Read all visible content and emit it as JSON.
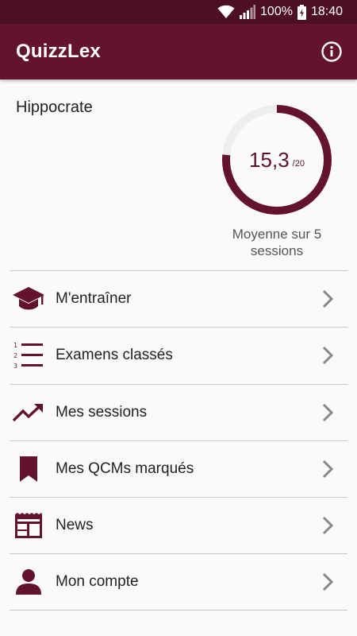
{
  "status_bar": {
    "battery_percent": "100%",
    "time": "18:40",
    "icons": [
      "wifi-icon",
      "signal-icon",
      "battery-icon"
    ]
  },
  "app_bar": {
    "title": "QuizzLex",
    "info_icon": "info-icon"
  },
  "profile": {
    "name": "Hippocrate",
    "score": "15,3",
    "score_max": "/20",
    "score_fraction": 0.765,
    "caption": "Moyenne sur 5 sessions"
  },
  "menu": {
    "items": [
      {
        "label": "M'entraîner",
        "icon": "graduation-cap-icon"
      },
      {
        "label": "Examens classés",
        "icon": "ordered-list-icon"
      },
      {
        "label": "Mes sessions",
        "icon": "trending-up-icon"
      },
      {
        "label": "Mes QCMs marqués",
        "icon": "bookmark-icon"
      },
      {
        "label": "News",
        "icon": "newspaper-icon"
      },
      {
        "label": "Mon compte",
        "icon": "person-icon"
      }
    ]
  },
  "colors": {
    "primary": "#63132d",
    "primary_dark": "#4d0f23",
    "ring_track": "#eeeeee",
    "background": "#fafafa"
  }
}
